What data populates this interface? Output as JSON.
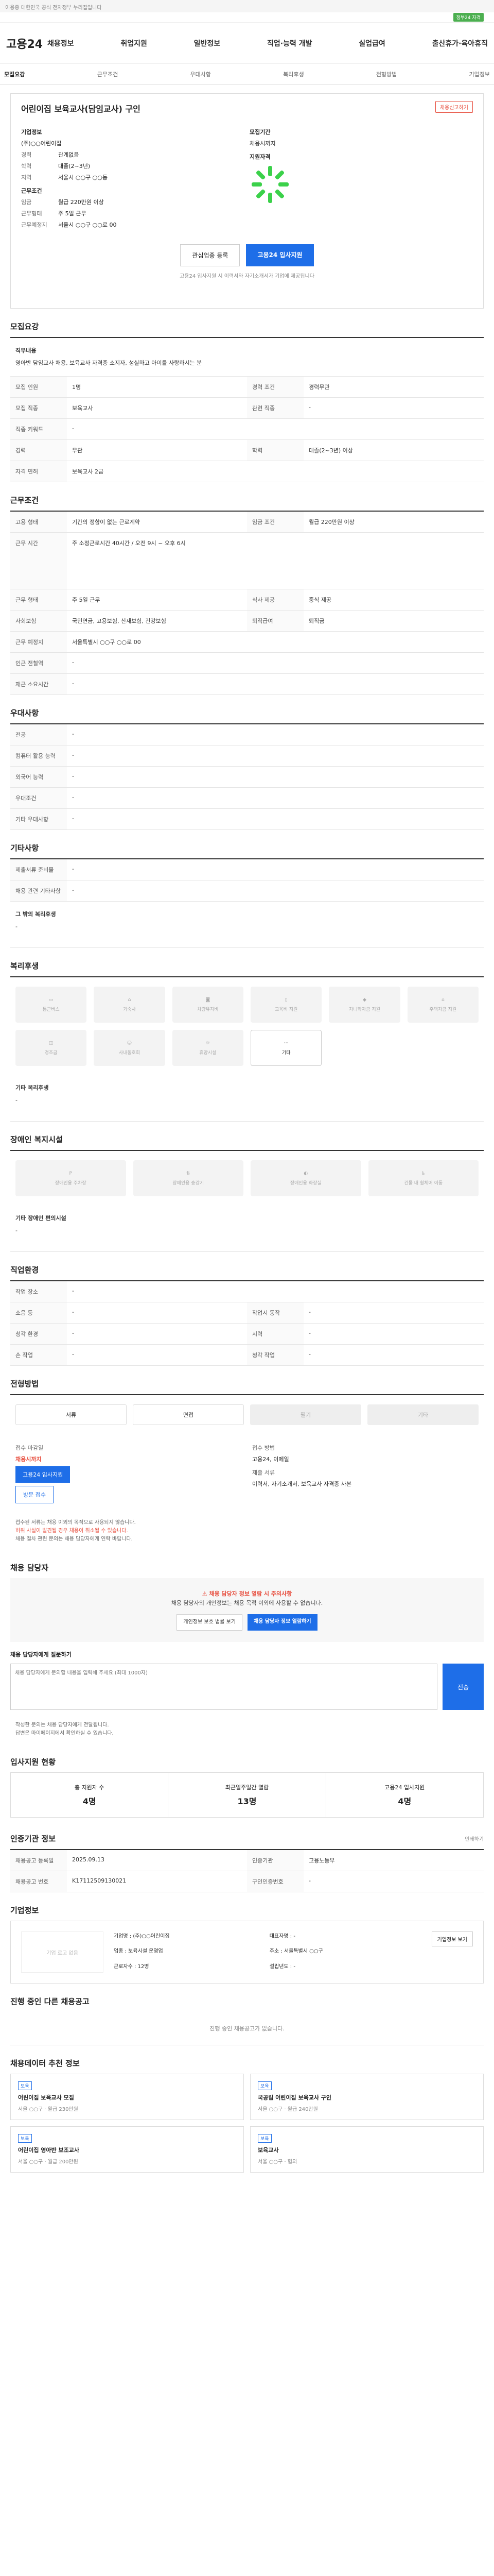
{
  "topbar": {
    "notice": "이용중 대한민국 공식 전자정부 누리집입니다",
    "badge": "정부24 자격"
  },
  "header": {
    "logo": "고용24",
    "menu": [
      "채용정보",
      "취업지원",
      "일반정보",
      "직업·능력 개발",
      "실업급여",
      "출산휴가·육아휴직"
    ]
  },
  "subnav": [
    "모집요강",
    "근무조건",
    "우대사항",
    "복리후생",
    "전형방법",
    "기업정보"
  ],
  "job": {
    "title": "어린이집 보육교사(담임교사) 구인",
    "report": "채용신고하기",
    "company_label": "기업정보",
    "company_name": "(주)○○어린이집",
    "period_label": "모집기간",
    "period_value": "채용시까지",
    "conditions_label": "근무조건",
    "apply_label": "지원자격",
    "rows": [
      {
        "k": "경력",
        "v": "관계없음"
      },
      {
        "k": "학력",
        "v": "대졸(2~3년)"
      },
      {
        "k": "지역",
        "v": "서울시 ○○구 ○○동"
      }
    ],
    "rows2": [
      {
        "k": "임금",
        "v": "월급 220만원 이상"
      },
      {
        "k": "근무형태",
        "v": "주 5일 근무"
      },
      {
        "k": "근무예정지",
        "v": "서울시 ○○구 ○○로 00"
      }
    ],
    "btn_interest": "관심업종 등록",
    "btn_apply": "고용24 입사지원",
    "note": "고용24 입사지원 시 이력서와 자기소개서가 기업에 제공됩니다"
  },
  "sections": {
    "recruit": "모집요강",
    "work": "근무조건",
    "prefer": "우대사항",
    "other": "기타사항",
    "welfare": "복리후생",
    "disabled": "장애인 복지시설",
    "personal": "직업환경",
    "process": "전형방법",
    "contact": "채용 담당자",
    "stats": "입사지원 현황",
    "reg": "인증기관 정보",
    "company": "기업정보",
    "other_jobs": "진행 중인 다른 채용공고",
    "reco": "채용데이터 추천 정보"
  },
  "recruit": {
    "duty_label": "직무내용",
    "duty": "영아반 담임교사 채용, 보육교사 자격증 소지자, 성실하고 아이를 사랑하시는 분",
    "rows": [
      {
        "k": "모집 인원",
        "v": "1명",
        "k2": "경력 조건",
        "v2": "경력무관"
      },
      {
        "k": "모집 직종",
        "v": "보육교사",
        "k2": "관련 직종",
        "v2": "-"
      },
      {
        "k": "직종 키워드",
        "v": "-",
        "k2": "",
        "v2": ""
      },
      {
        "k": "경력",
        "v": "무관",
        "k2": "학력",
        "v2": "대졸(2~3년) 이상"
      },
      {
        "k": "자격 면허",
        "v": "보육교사 2급",
        "k2": "",
        "v2": ""
      }
    ]
  },
  "work": {
    "rows": [
      {
        "k": "고용 형태",
        "v": "기간의 정함이 없는 근로계약",
        "k2": "임금 조건",
        "v2": "월급 220만원 이상"
      },
      {
        "k": "근무 시간",
        "v": "주 소정근로시간 40시간 / 오전 9시 ~ 오후 6시"
      },
      {
        "k": "근무 형태",
        "v": "주 5일 근무",
        "k2": "식사 제공",
        "v2": "중식 제공"
      },
      {
        "k": "사회보험",
        "v": "국민연금, 고용보험, 산재보험, 건강보험",
        "k2": "퇴직급여",
        "v2": "퇴직금"
      },
      {
        "k": "근무 예정지",
        "v": "서울특별시 ○○구 ○○로 00"
      },
      {
        "k": "인근 전철역",
        "v": "-"
      },
      {
        "k": "재근 소요시간",
        "v": "-"
      }
    ]
  },
  "prefer": {
    "rows": [
      {
        "k": "전공",
        "v": "-"
      },
      {
        "k": "컴퓨터 활용 능력",
        "v": "-"
      },
      {
        "k": "외국어 능력",
        "v": "-"
      },
      {
        "k": "우대조건",
        "v": "-"
      },
      {
        "k": "기타 우대사항",
        "v": "-"
      }
    ]
  },
  "other": {
    "rows": [
      {
        "k": "제출서류 준비물",
        "v": "-"
      },
      {
        "k": "채용 관련 기타사항",
        "v": "-"
      }
    ],
    "extra_label": "그 밖의 복리후생",
    "extra": "-"
  },
  "welfare": {
    "tiles": [
      "통근버스",
      "기숙사",
      "차량유지비",
      "교육비 지원",
      "자녀학자금 지원",
      "주택자금 지원",
      "경조금",
      "사내동호회",
      "휴양시설",
      "기타"
    ],
    "extra_label": "기타 복리후생",
    "extra": "-"
  },
  "disabled": {
    "tiles": [
      "장애인용 주차장",
      "장애인용 승강기",
      "장애인용 화장실",
      "건물 내 휠체어 이동"
    ],
    "extra_label": "기타 장애인 편의시설",
    "extra": "-"
  },
  "personal": {
    "rows": [
      {
        "k": "작업 장소",
        "v": "-",
        "k2": "",
        "v2": ""
      },
      {
        "k": "소음 등",
        "v": "-",
        "k2": "작업시 동작",
        "v2": "-"
      },
      {
        "k": "청각 환경",
        "v": "-",
        "k2": "시력",
        "v2": "-"
      },
      {
        "k": "손 작업",
        "v": "-",
        "k2": "청각 작업",
        "v2": "-"
      }
    ]
  },
  "process": {
    "tags": [
      "서류",
      "면접",
      "필기",
      "기타"
    ],
    "received_label": "접수 마감일",
    "received_value": "채용시까지",
    "method_label": "접수 방법",
    "method_value": "고용24, 이메일",
    "apply_btn": "고용24 입사지원",
    "visit_btn": "방문 접수",
    "docs_label": "제출 서류",
    "docs_value": "이력서, 자기소개서, 보육교사 자격증 사본",
    "bullets": [
      "접수된 서류는 채용 이외의 목적으로 사용되지 않습니다.",
      "허위 사실이 발견될 경우 채용이 취소될 수 있습니다.",
      "채용 절차 관련 문의는 채용 담당자에게 연락 바랍니다."
    ]
  },
  "contact": {
    "warn_title": "채용 담당자 정보 열람 시 주의사항",
    "warn_text": "채용 담당자의 개인정보는 채용 목적 이외에 사용할 수 없습니다.",
    "btn_view": "개인정보 보호 법률 보기",
    "btn_open": "채용 담당자 정보 열람하기",
    "inquiry_label": "채용 담당자에게 질문하기",
    "inquiry_placeholder": "채용 담당자에게 문의할 내용을 입력해 주세요 (최대 1000자)",
    "inquiry_send": "전송",
    "notes": [
      "작성한 문의는 채용 담당자에게 전달됩니다.",
      "답변은 마이페이지에서 확인하실 수 있습니다."
    ]
  },
  "stats": {
    "items": [
      {
        "label": "총 지원자 수",
        "value": "4명"
      },
      {
        "label": "최근일주일간 열람",
        "value": "13명"
      },
      {
        "label": "고용24 입사지원",
        "value": "4명"
      }
    ]
  },
  "reg": {
    "rows": [
      {
        "k": "채용공고 등록일",
        "v": "2025.09.13",
        "k2": "인증기관",
        "v2": "고용노동부"
      },
      {
        "k": "채용공고 번호",
        "v": "K17112509130021",
        "k2": "구인인증번호",
        "v2": "-"
      }
    ],
    "print": "인쇄하기"
  },
  "company": {
    "logo_alt": "기업 로고 없음",
    "rows": [
      {
        "k": "기업명",
        "v": "(주)○○어린이집"
      },
      {
        "k": "대표자명",
        "v": "-"
      },
      {
        "k": "업종",
        "v": "보육시설 운영업"
      },
      {
        "k": "주소",
        "v": "서울특별시 ○○구"
      },
      {
        "k": "근로자수",
        "v": "12명"
      },
      {
        "k": "설립년도",
        "v": "-"
      }
    ],
    "btn": "기업정보 보기"
  },
  "other_jobs": {
    "empty": "진행 중인 채용공고가 없습니다."
  },
  "reco": {
    "cards": [
      {
        "tag": "보육",
        "title": "어린이집 보육교사 모집",
        "meta": "서울 ○○구 · 월급 230만원"
      },
      {
        "tag": "보육",
        "title": "국공립 어린이집 보육교사 구인",
        "meta": "서울 ○○구 · 월급 240만원"
      },
      {
        "tag": "보육",
        "title": "어린이집 영아반 보조교사",
        "meta": "서울 ○○구 · 월급 200만원"
      },
      {
        "tag": "보육",
        "title": "보육교사",
        "meta": "서울 ○○구 · 협의"
      }
    ]
  }
}
